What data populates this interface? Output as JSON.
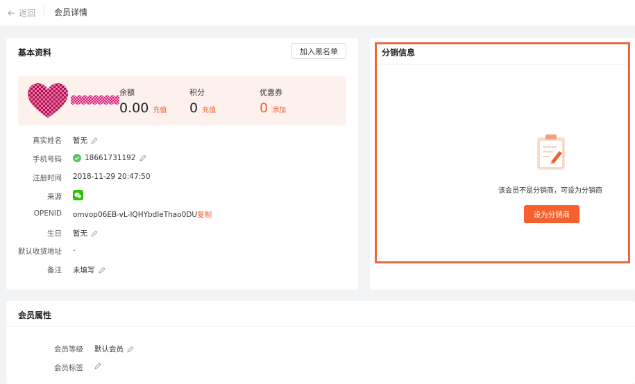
{
  "header": {
    "back_label": "返回",
    "page_title": "会员详情"
  },
  "basic": {
    "title": "基本资料",
    "blacklist_label": "加入黑名单",
    "stats": [
      {
        "label": "余额",
        "value": "0.00",
        "action": "充值"
      },
      {
        "label": "积分",
        "value": "0",
        "action": "充值"
      },
      {
        "label": "优惠券",
        "value": "0",
        "action": "添加"
      }
    ],
    "fields": {
      "real_name": {
        "label": "真实姓名",
        "value": "暂无"
      },
      "phone": {
        "label": "手机号码",
        "value": "18661731192"
      },
      "register_time": {
        "label": "注册时间",
        "value": "2018-11-29 20:47:50"
      },
      "source": {
        "label": "来源"
      },
      "openid": {
        "label": "OPENID",
        "value": "omvop06EB-vL-IQHYbdleThao0DU",
        "copy": "复制"
      },
      "birthday": {
        "label": "生日",
        "value": "暂无"
      },
      "address": {
        "label": "默认收货地址",
        "value": "-"
      },
      "remark": {
        "label": "备注",
        "value": "未填写"
      }
    }
  },
  "distribution": {
    "title": "分销信息",
    "empty_text": "该会员不是分销商，可设为分销商",
    "set_button": "设为分销商"
  },
  "attributes": {
    "title": "会员属性",
    "level": {
      "label": "会员等级",
      "value": "默认会员"
    },
    "tags": {
      "label": "会员标签"
    }
  },
  "colors": {
    "accent": "#f4602e",
    "highlight_border": "#e8693f",
    "summary_bg": "#fdf1ee",
    "wechat_green": "#2dc100"
  }
}
